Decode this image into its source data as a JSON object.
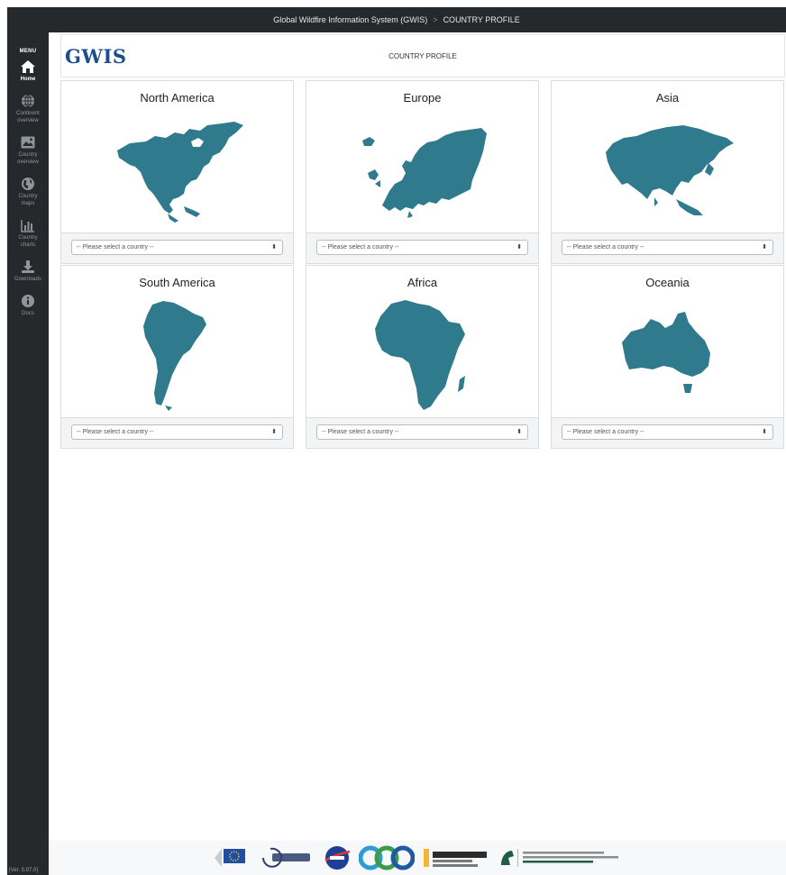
{
  "topbar": {
    "system": "Global Wildfire Information System (GWIS)",
    "separator": ">",
    "page": "COUNTRY PROFILE"
  },
  "sidebar": {
    "menu_label": "MENU",
    "items": [
      {
        "label": "Home",
        "icon": "home-icon",
        "active": true
      },
      {
        "label": "Continent\noverview",
        "icon": "globe-grid-icon"
      },
      {
        "label": "Country\noverview",
        "icon": "image-icon"
      },
      {
        "label": "Country\nmaps",
        "icon": "globe-icon"
      },
      {
        "label": "Country\ncharts",
        "icon": "bar-chart-icon"
      },
      {
        "label": "Downloads",
        "icon": "download-icon"
      },
      {
        "label": "Docs",
        "icon": "info-icon"
      }
    ],
    "version": "[Ver. 0.97.0]"
  },
  "header": {
    "logo": "GWIS",
    "title": "COUNTRY PROFILE"
  },
  "continents": [
    {
      "name": "North America",
      "placeholder": "-- Please select a country --"
    },
    {
      "name": "Europe",
      "placeholder": "-- Please select a country --"
    },
    {
      "name": "Asia",
      "placeholder": "-- Please select a country --"
    },
    {
      "name": "South America",
      "placeholder": "-- Please select a country --"
    },
    {
      "name": "Africa",
      "placeholder": "-- Please select a country --"
    },
    {
      "name": "Oceania",
      "placeholder": "-- Please select a country --"
    }
  ],
  "colors": {
    "map_fill": "#2f7a8c",
    "sidebar_bg": "#25292c",
    "logo": "#1b4e8c"
  },
  "partners": [
    "European Commission",
    "Copernicus",
    "NASA",
    "GEO",
    "University of Idaho",
    "Department of Geography, Environment, and Spatial Sciences"
  ]
}
